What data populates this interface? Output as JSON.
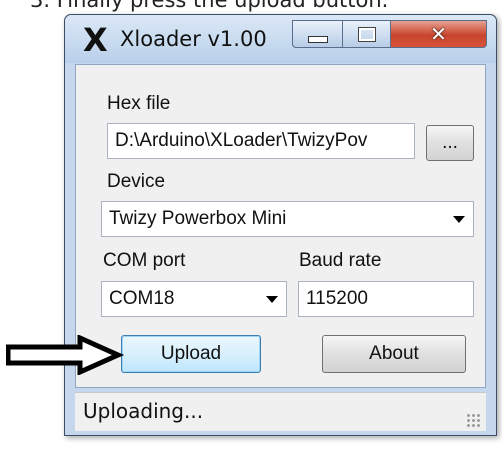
{
  "doc_caption": "3.   Finally press the upload button.",
  "window": {
    "title": "Xloader v1.00",
    "icon": "x-logo-icon"
  },
  "form": {
    "hex_file_label": "Hex file",
    "hex_file_value": "D:\\Arduino\\XLoader\\TwizyPov",
    "browse_label": "...",
    "device_label": "Device",
    "device_value": "Twizy Powerbox Mini",
    "com_port_label": "COM port",
    "com_port_value": "COM18",
    "baud_rate_label": "Baud rate",
    "baud_rate_value": "115200",
    "upload_label": "Upload",
    "about_label": "About"
  },
  "status": {
    "text": "Uploading..."
  },
  "annotation": {
    "icon": "arrow-right-icon"
  }
}
